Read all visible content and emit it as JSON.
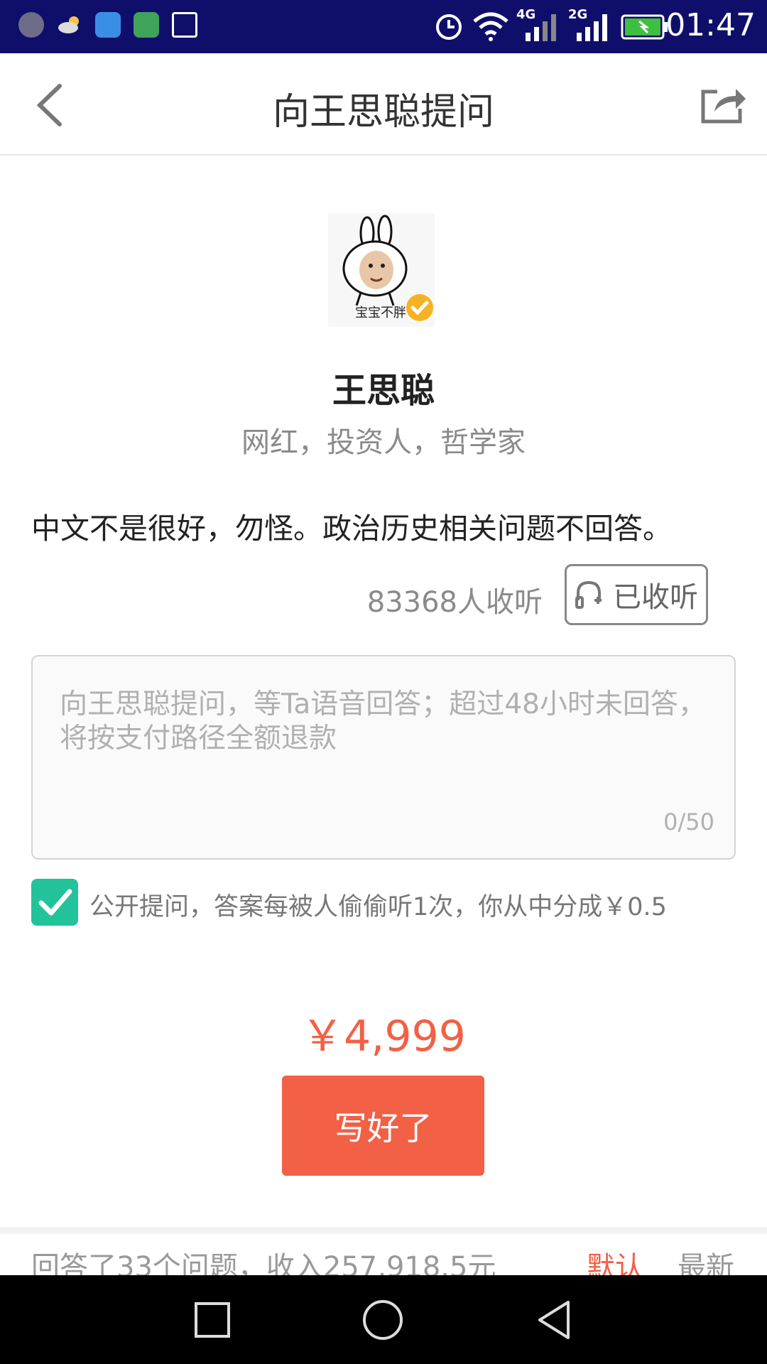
{
  "status_bar": {
    "time": "01:47",
    "signal_labels": [
      "4G",
      "2G"
    ]
  },
  "header": {
    "title": "向王思聪提问"
  },
  "profile": {
    "avatar_caption": "宝宝不胖",
    "name": "王思聪",
    "tags": "网红，投资人，哲学家",
    "bio": "中文不是很好，勿怪。政治历史相关问题不回答。",
    "listeners": "83368人收听",
    "listen_button": "已收听"
  },
  "question": {
    "placeholder": "向王思聪提问，等Ta语音回答；超过48小时未回答，将按支付路径全额退款",
    "value": "",
    "counter": "0/50"
  },
  "public_option": {
    "checked": true,
    "label": "公开提问，答案每被人偷偷听1次，你从中分成￥0.5"
  },
  "price": "￥4,999",
  "submit_label": "写好了",
  "summary": {
    "text": "回答了33个问题，收入257,918.5元",
    "sort_default": "默认",
    "sort_new": "最新"
  },
  "colors": {
    "accent": "#f26046",
    "checkbox": "#22c29a",
    "status_bar": "#0f0f6b"
  }
}
